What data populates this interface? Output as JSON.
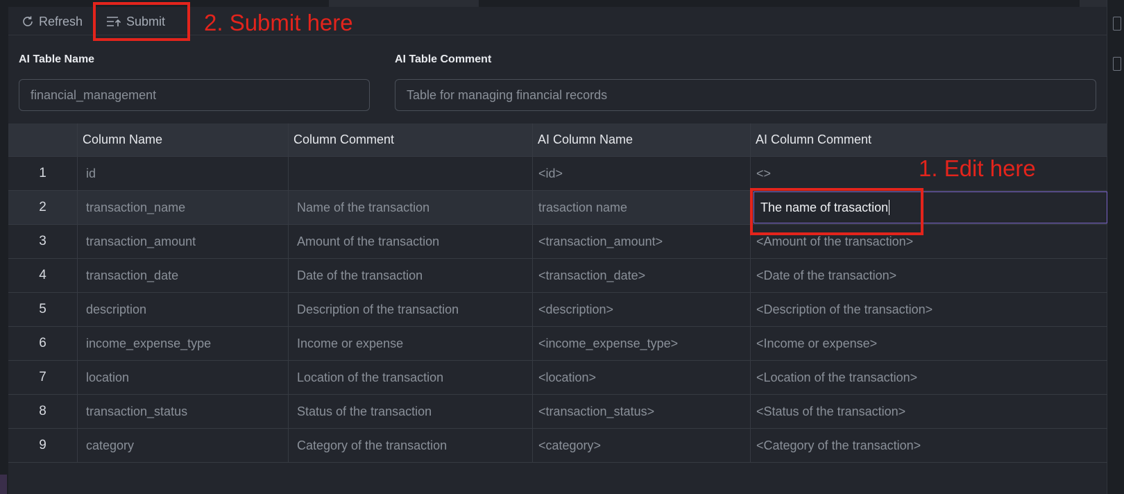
{
  "toolbar": {
    "refresh_label": "Refresh",
    "submit_label": "Submit"
  },
  "annotations": {
    "submit_note": "2. Submit here",
    "edit_note": "1. Edit here"
  },
  "form": {
    "table_name_label": "AI Table Name",
    "table_name_value": "financial_management",
    "table_comment_label": "AI Table Comment",
    "table_comment_value": "Table for managing financial records"
  },
  "table": {
    "headers": [
      "",
      "Column Name",
      "Column Comment",
      "AI Column Name",
      "AI Column Comment"
    ],
    "rows": [
      {
        "n": "1",
        "name": "id",
        "comment": "",
        "ai_name": "<id>",
        "ai_comment": "<>"
      },
      {
        "n": "2",
        "name": "transaction_name",
        "comment": "Name of the transaction",
        "ai_name": "trasaction name",
        "ai_comment": "The name of trasaction"
      },
      {
        "n": "3",
        "name": "transaction_amount",
        "comment": "Amount of the transaction",
        "ai_name": "<transaction_amount>",
        "ai_comment": "<Amount of the transaction>"
      },
      {
        "n": "4",
        "name": "transaction_date",
        "comment": "Date of the transaction",
        "ai_name": "<transaction_date>",
        "ai_comment": "<Date of the transaction>"
      },
      {
        "n": "5",
        "name": "description",
        "comment": "Description of the transaction",
        "ai_name": "<description>",
        "ai_comment": "<Description of the transaction>"
      },
      {
        "n": "6",
        "name": "income_expense_type",
        "comment": "Income or expense",
        "ai_name": "<income_expense_type>",
        "ai_comment": "<Income or expense>"
      },
      {
        "n": "7",
        "name": "location",
        "comment": "Location of the transaction",
        "ai_name": "<location>",
        "ai_comment": "<Location of the transaction>"
      },
      {
        "n": "8",
        "name": "transaction_status",
        "comment": "Status of the transaction",
        "ai_name": "<transaction_status>",
        "ai_comment": "<Status of the transaction>"
      },
      {
        "n": "9",
        "name": "category",
        "comment": "Category of the transaction",
        "ai_name": "<category>",
        "ai_comment": "<Category of the transaction>"
      }
    ]
  },
  "icons": {
    "refresh": "refresh-icon",
    "submit": "submit-icon"
  },
  "colors": {
    "background": "#23262d",
    "annotation": "#e3241c",
    "edit_border": "#7a64c8"
  }
}
